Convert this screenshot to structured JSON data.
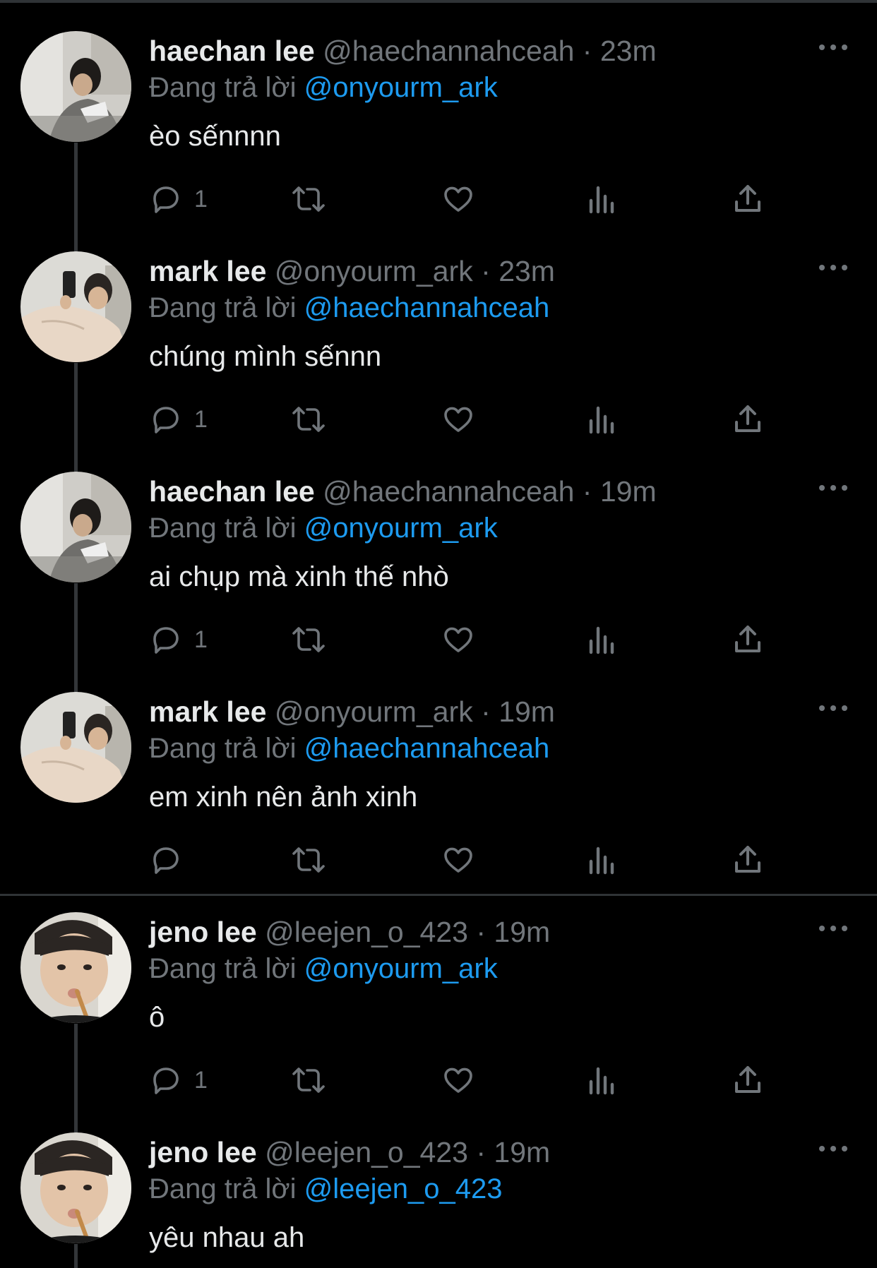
{
  "reply_prefix": "Đang trả lời",
  "separator": "·",
  "colors": {
    "background": "#000000",
    "text": "#e7e9ea",
    "muted": "#71767b",
    "mention": "#1d9bf0",
    "line": "#333639"
  },
  "tweets": [
    {
      "name": "haechan lee",
      "handle": "@haechannahceah",
      "time": "23m",
      "reply_to": "@onyourm_ark",
      "text": "èo sếnnnn",
      "reply_count": "1",
      "avatar": "avatar-haechan"
    },
    {
      "name": "mark lee",
      "handle": "@onyourm_ark",
      "time": "23m",
      "reply_to": "@haechannahceah",
      "text": "chúng mình sếnnn",
      "reply_count": "1",
      "avatar": "avatar-mark"
    },
    {
      "name": "haechan lee",
      "handle": "@haechannahceah",
      "time": "19m",
      "reply_to": "@onyourm_ark",
      "text": "ai chụp mà xinh thế nhò",
      "reply_count": "1",
      "avatar": "avatar-haechan"
    },
    {
      "name": "mark lee",
      "handle": "@onyourm_ark",
      "time": "19m",
      "reply_to": "@haechannahceah",
      "text": "em xinh nên ảnh xinh",
      "reply_count": "",
      "avatar": "avatar-mark"
    },
    {
      "name": "jeno lee",
      "handle": "@leejen_o_423",
      "time": "19m",
      "reply_to": "@onyourm_ark",
      "text": "ô",
      "reply_count": "1",
      "avatar": "avatar-jeno"
    },
    {
      "name": "jeno lee",
      "handle": "@leejen_o_423",
      "time": "19m",
      "reply_to": "@leejen_o_423",
      "text": "yêu nhau ah",
      "reply_count": "",
      "avatar": "avatar-jeno"
    }
  ],
  "icons": {
    "reply": "reply-icon",
    "retweet": "retweet-icon",
    "like": "heart-icon",
    "views": "analytics-icon",
    "share": "share-icon",
    "more": "more-icon"
  }
}
